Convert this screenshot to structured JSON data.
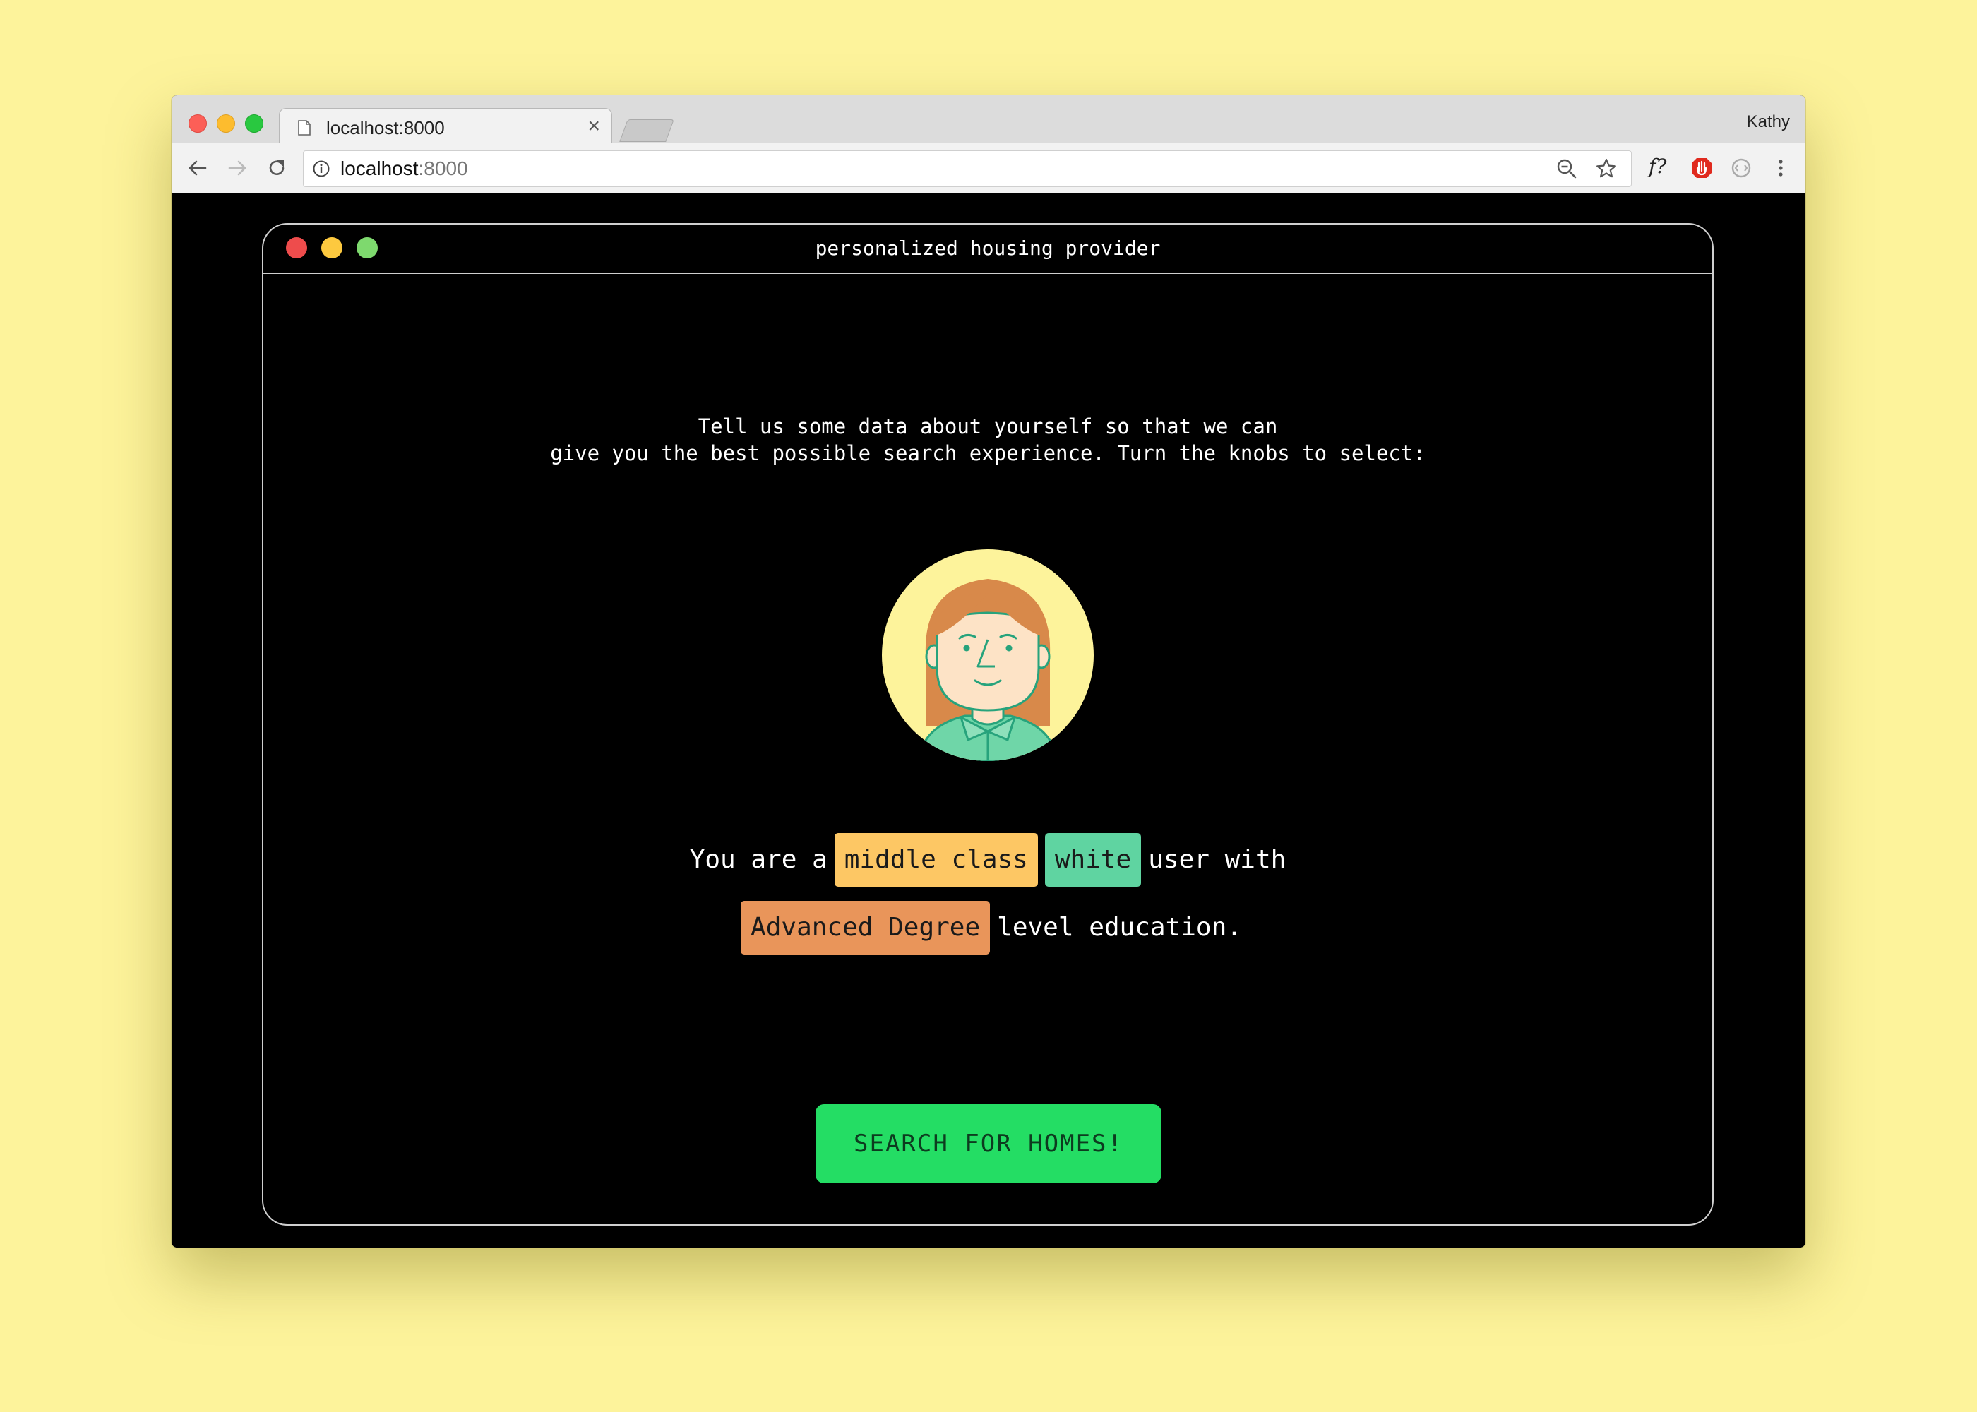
{
  "browser": {
    "tab": {
      "title": "localhost:8000",
      "close": "×"
    },
    "profile": "Kathy",
    "url": {
      "host": "localhost",
      "port": ":8000"
    },
    "extension_label": "f?"
  },
  "app": {
    "title": "personalized housing provider",
    "intro_line1": "Tell us some data about yourself so that we can",
    "intro_line2": "give you the best possible search experience. Turn the knobs to select:",
    "sentence": {
      "part1": "You are a",
      "class": "middle class",
      "race": "white",
      "part2": "user with",
      "education": "Advanced Degree",
      "part3": "level education."
    },
    "cta_label": "SEARCH FOR HOMES!"
  },
  "colors": {
    "page_bg": "#fdf39b",
    "chip_class": "#fdc764",
    "chip_race": "#5fd4a1",
    "chip_edu": "#e9955a",
    "cta": "#24dd64"
  },
  "icons": [
    "document-icon",
    "close-icon",
    "back-arrow-icon",
    "forward-arrow-icon",
    "reload-icon",
    "info-icon",
    "zoom-icon",
    "star-icon",
    "extension-icon",
    "vpn-icon",
    "menu-icon",
    "avatar-illustration"
  ]
}
